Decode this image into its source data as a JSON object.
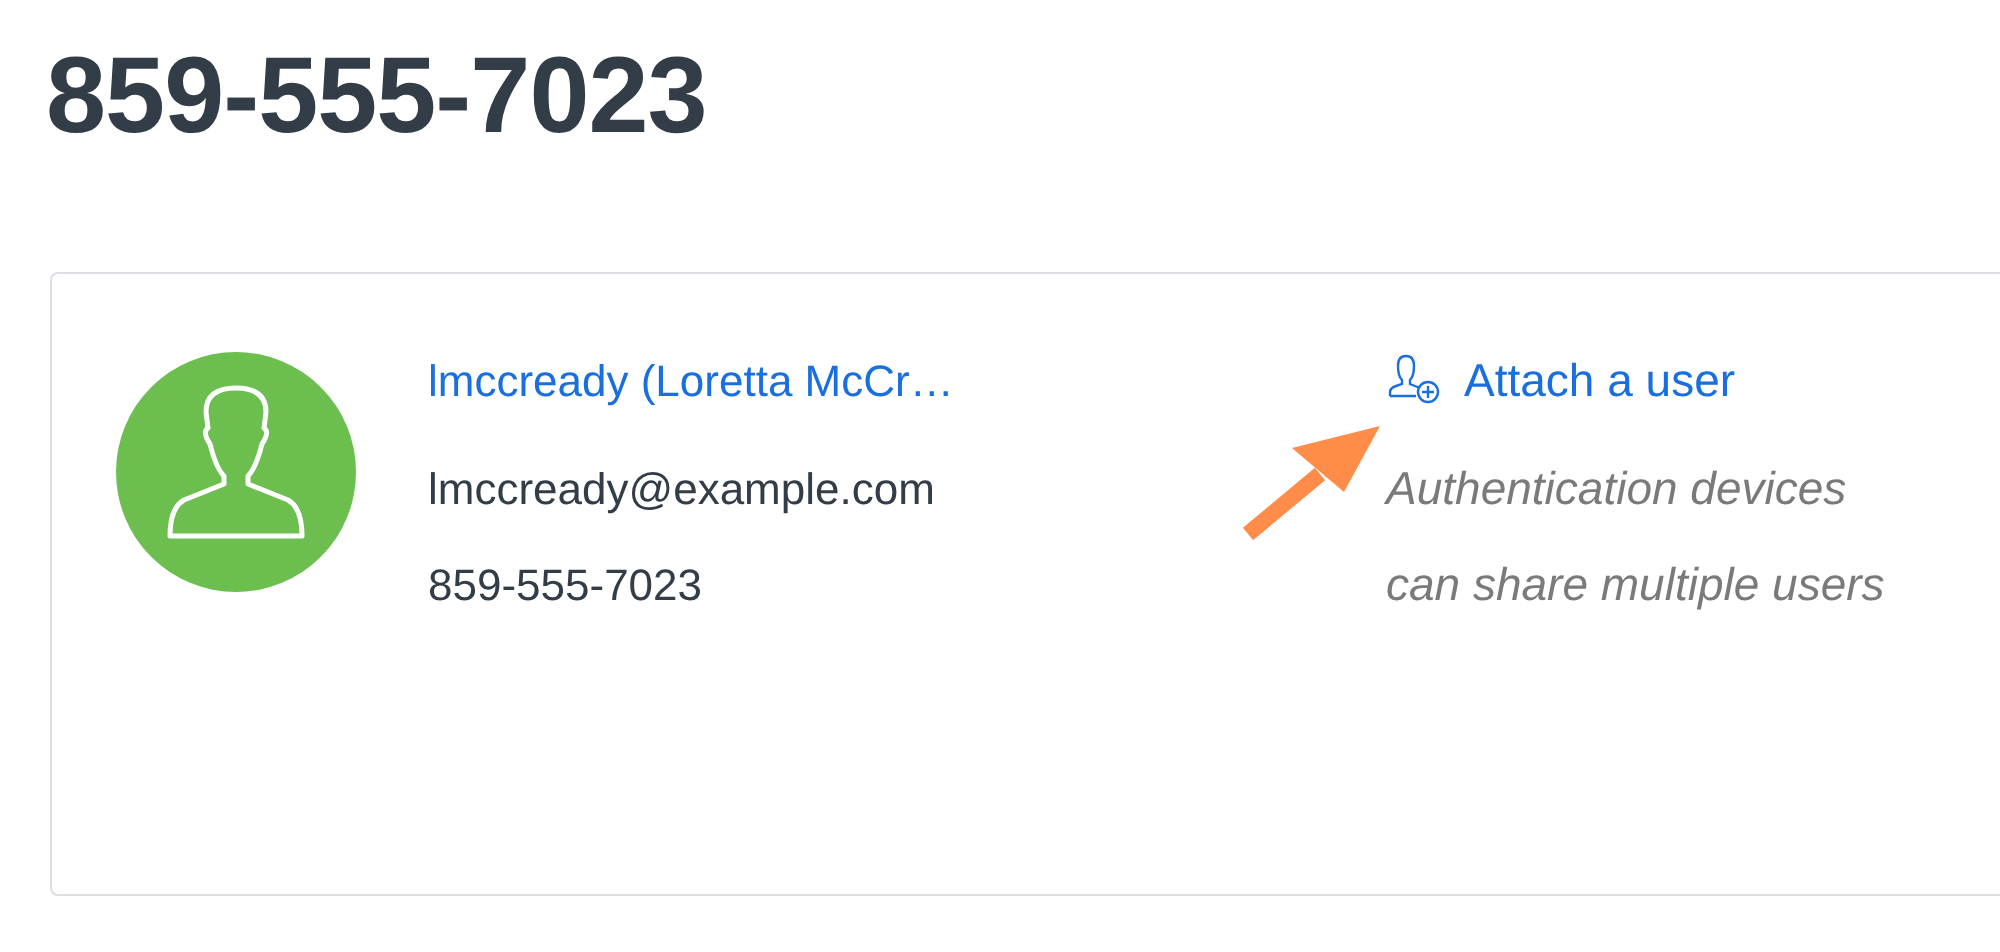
{
  "title": "859-555-7023",
  "user": {
    "name": "lmccready (Loretta McCr…",
    "email": "lmccready@example.com",
    "phone": "859-555-7023"
  },
  "attach": {
    "label": "Attach a user",
    "help": "Authentication devices can share multiple users"
  }
}
